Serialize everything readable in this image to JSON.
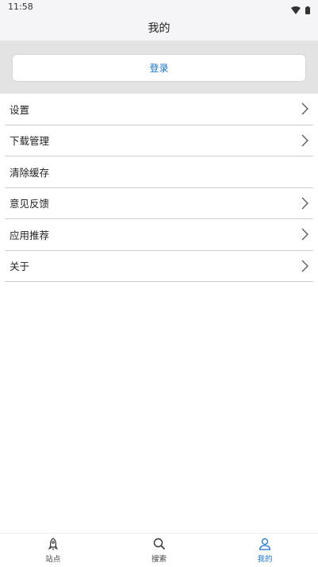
{
  "status_bar": {
    "time": "11:58"
  },
  "header": {
    "title": "我的"
  },
  "login": {
    "label": "登录"
  },
  "menu": {
    "items": [
      {
        "label": "设置",
        "has_chevron": true
      },
      {
        "label": "下载管理",
        "has_chevron": true
      },
      {
        "label": "清除缓存",
        "has_chevron": false
      },
      {
        "label": "意见反馈",
        "has_chevron": true
      },
      {
        "label": "应用推荐",
        "has_chevron": true
      },
      {
        "label": "关于",
        "has_chevron": true
      }
    ]
  },
  "tabs": [
    {
      "label": "站点",
      "icon": "rocket-icon",
      "active": false
    },
    {
      "label": "搜索",
      "icon": "search-icon",
      "active": false
    },
    {
      "label": "我的",
      "icon": "person-icon",
      "active": true
    }
  ],
  "colors": {
    "accent": "#1a73c9",
    "header_bg": "#f5f5f7",
    "login_area_bg": "#e3e3e3"
  }
}
